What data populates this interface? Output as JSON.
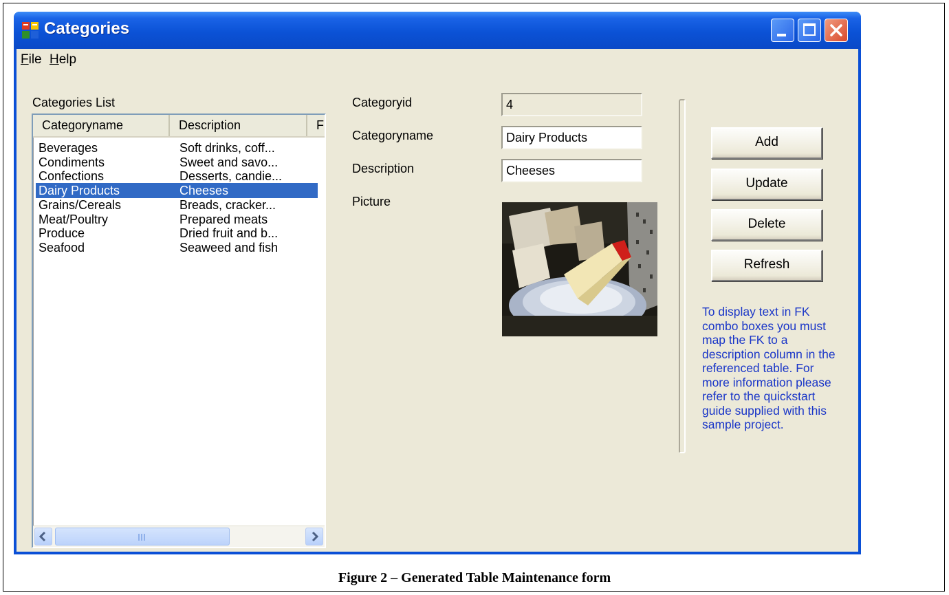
{
  "window": {
    "title": "Categories"
  },
  "menu": {
    "items": [
      {
        "underline": "F",
        "rest": "ile"
      },
      {
        "underline": "H",
        "rest": "elp"
      }
    ]
  },
  "list": {
    "label": "Categories List",
    "columns": [
      "Categoryname",
      "Description",
      "F"
    ],
    "rows": [
      {
        "name": "Beverages",
        "description": "Soft drinks, coff..."
      },
      {
        "name": "Condiments",
        "description": "Sweet and savo..."
      },
      {
        "name": "Confections",
        "description": "Desserts, candie..."
      },
      {
        "name": "Dairy Products",
        "description": "Cheeses"
      },
      {
        "name": "Grains/Cereals",
        "description": "Breads, cracker..."
      },
      {
        "name": "Meat/Poultry",
        "description": "Prepared meats"
      },
      {
        "name": "Produce",
        "description": "Dried fruit and b..."
      },
      {
        "name": "Seafood",
        "description": "Seaweed and fish"
      }
    ],
    "selected_index": 3
  },
  "form": {
    "categoryid_label": "Categoryid",
    "categoryid_value": "4",
    "categoryname_label": "Categoryname",
    "categoryname_value": "Dairy Products",
    "description_label": "Description",
    "description_value": "Cheeses",
    "picture_label": "Picture"
  },
  "buttons": {
    "add": "Add",
    "update": "Update",
    "delete": "Delete",
    "refresh": "Refresh"
  },
  "note": "To display text in FK combo boxes you must map the FK to a description column in the referenced table. For more information please refer to the quickstart guide supplied with this sample project.",
  "caption": "Figure 2 – Generated Table Maintenance form",
  "colors": {
    "titlebar": "#0b52d6",
    "selection": "#316ac5",
    "note_text": "#1a36c8",
    "client_bg": "#ece9d8"
  }
}
